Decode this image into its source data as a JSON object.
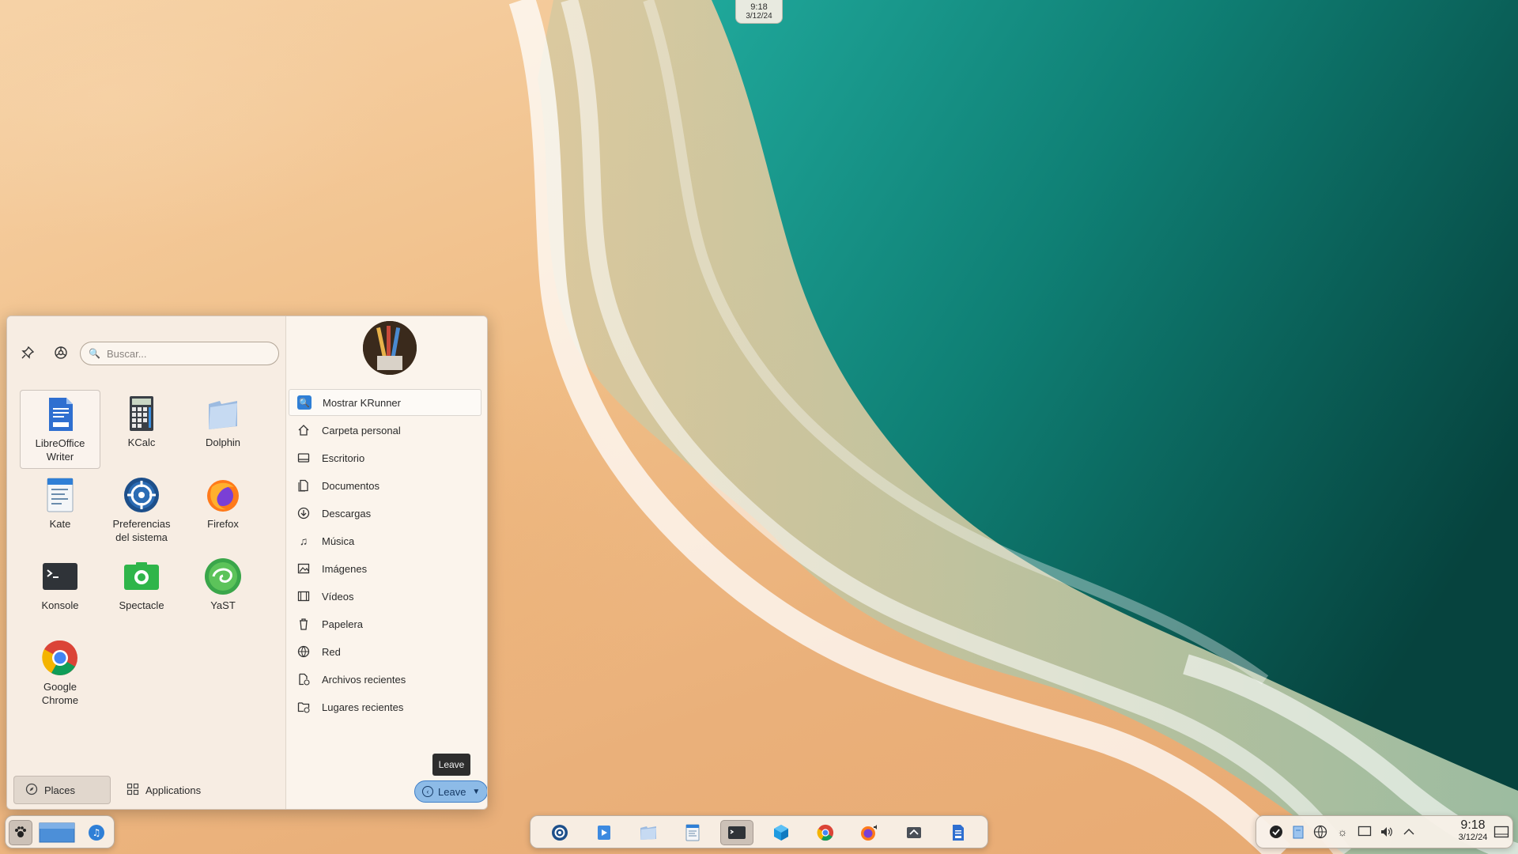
{
  "top_clock": {
    "time": "9:18",
    "date": "3/12/24"
  },
  "launcher": {
    "search": {
      "placeholder": "Buscar..."
    },
    "apps": [
      {
        "label": "LibreOffice\nWriter",
        "icon": "libreoffice-writer-icon"
      },
      {
        "label": "KCalc",
        "icon": "kcalc-icon"
      },
      {
        "label": "Dolphin",
        "icon": "dolphin-icon"
      },
      {
        "label": "Kate",
        "icon": "kate-icon"
      },
      {
        "label": "Preferencias\ndel sistema",
        "icon": "system-settings-icon"
      },
      {
        "label": "Firefox",
        "icon": "firefox-icon"
      },
      {
        "label": "Konsole",
        "icon": "konsole-icon"
      },
      {
        "label": "Spectacle",
        "icon": "spectacle-icon"
      },
      {
        "label": "YaST",
        "icon": "yast-icon"
      },
      {
        "label": "Google\nChrome",
        "icon": "chrome-icon"
      }
    ],
    "tabs": {
      "places": "Places",
      "applications": "Applications"
    },
    "places": [
      {
        "label": "Mostrar KRunner",
        "icon": "krunner-icon"
      },
      {
        "label": "Carpeta personal",
        "icon": "home-icon"
      },
      {
        "label": "Escritorio",
        "icon": "desktop-icon"
      },
      {
        "label": "Documentos",
        "icon": "documents-icon"
      },
      {
        "label": "Descargas",
        "icon": "downloads-icon"
      },
      {
        "label": "Música",
        "icon": "music-icon"
      },
      {
        "label": "Imágenes",
        "icon": "pictures-icon"
      },
      {
        "label": "Vídeos",
        "icon": "videos-icon"
      },
      {
        "label": "Papelera",
        "icon": "trash-icon"
      },
      {
        "label": "Red",
        "icon": "network-icon"
      },
      {
        "label": "Archivos recientes",
        "icon": "recent-files-icon"
      },
      {
        "label": "Lugares recientes",
        "icon": "recent-places-icon"
      }
    ],
    "leave_tooltip": "Leave",
    "leave_label": "Leave"
  },
  "taskbar": {
    "clock": {
      "time": "9:18",
      "date": "3/12/24"
    }
  },
  "colors": {
    "accent": "#3f7fc8",
    "panel_bg": "#f8f0e8",
    "sand": "#f0bd86",
    "sea": "#0f6a66"
  }
}
